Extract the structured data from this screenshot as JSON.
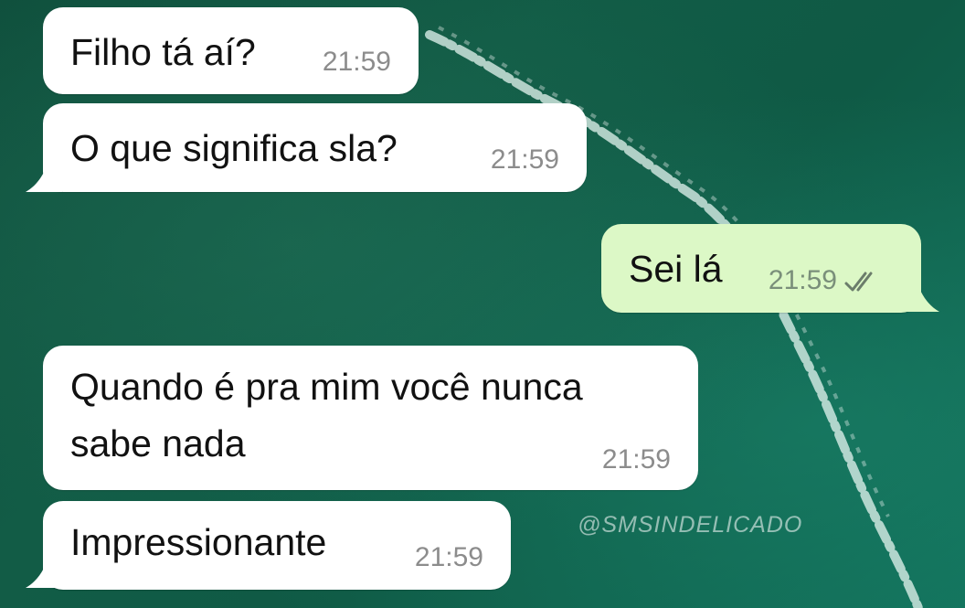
{
  "messages": [
    {
      "direction": "incoming",
      "text": "Filho tá aí?",
      "time": "21:59"
    },
    {
      "direction": "incoming",
      "text": "O que significa sla?",
      "time": "21:59"
    },
    {
      "direction": "outgoing",
      "text": "Sei lá",
      "time": "21:59",
      "status": "read"
    },
    {
      "direction": "incoming",
      "text_lines": [
        "Quando é pra mim você nunca",
        "sabe nada"
      ],
      "time": "21:59"
    },
    {
      "direction": "incoming",
      "text": "Impressionante",
      "time": "21:59"
    }
  ],
  "watermark": "@SMSINDELICADO",
  "colors": {
    "incoming_bubble": "#ffffff",
    "outgoing_bubble": "#dcf8c6",
    "background": "#125c46",
    "read_ticks": "#6b7d6b"
  },
  "icons": {
    "read_status": "double-check-icon"
  }
}
